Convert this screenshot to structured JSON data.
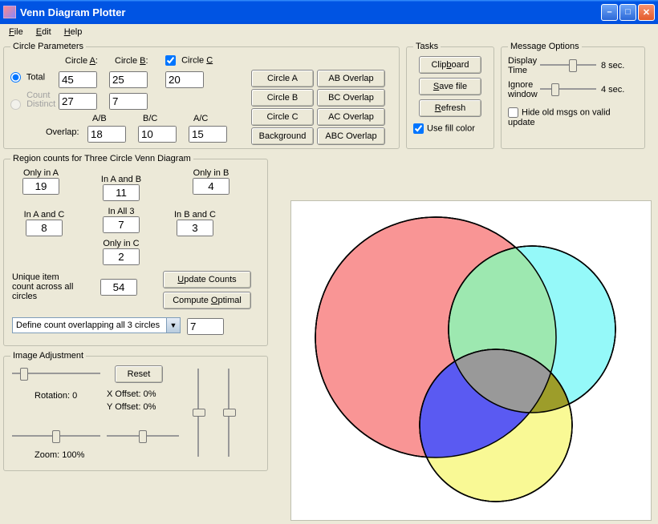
{
  "window": {
    "title": "Venn Diagram Plotter"
  },
  "menu": {
    "file": "File",
    "edit": "Edit",
    "help": "Help"
  },
  "circleParams": {
    "legend": "Circle Parameters",
    "labelA": "Circle A:",
    "labelB": "Circle B:",
    "labelC": "Circle C",
    "totalLabel": "Total",
    "countDistinctLabel": "Count Distinct",
    "totalA": "45",
    "totalB": "25",
    "totalC": "20",
    "distinctA": "27",
    "distinctB": "7",
    "overlapLabel": "Overlap:",
    "ab_hdr": "A/B",
    "bc_hdr": "B/C",
    "ac_hdr": "A/C",
    "ab": "18",
    "bc": "10",
    "ac": "15",
    "btnCircleA": "Circle A",
    "btnCircleB": "Circle B",
    "btnCircleC": "Circle C",
    "btnBackground": "Background",
    "btnAB": "AB Overlap",
    "btnBC": "BC Overlap",
    "btnAC": "AC Overlap",
    "btnABC": "ABC Overlap"
  },
  "tasks": {
    "legend": "Tasks",
    "clipboard": "Clipboard",
    "savefile": "Save file",
    "refresh": "Refresh",
    "useFillLabel": "Use fill color"
  },
  "msgopts": {
    "legend": "Message Options",
    "displayTime": "Display Time",
    "displayTimeVal": "8 sec.",
    "ignoreWindow": "Ignore window",
    "ignoreWindowVal": "4 sec.",
    "hideOld": "Hide old msgs on valid update"
  },
  "regions": {
    "legend": "Region counts for Three Circle Venn Diagram",
    "onlyA_lbl": "Only in A",
    "onlyA": "19",
    "ab_lbl": "In A and B",
    "ab": "11",
    "onlyB_lbl": "Only in B",
    "onlyB": "4",
    "ac_lbl": "In A and C",
    "ac": "8",
    "all3_lbl": "In All 3",
    "all3": "7",
    "bc_lbl": "In B and C",
    "bc": "3",
    "onlyC_lbl": "Only in C",
    "onlyC": "2",
    "unique_lbl": "Unique item count across all circles",
    "unique": "54",
    "updateCounts": "Update Counts",
    "computeOptimal": "Compute Optimal",
    "dropdown": "Define count overlapping all 3 circles",
    "dropdownVal": "7"
  },
  "imgAdj": {
    "legend": "Image Adjustment",
    "reset": "Reset",
    "rotation": "Rotation: 0",
    "xoffset": "X Offset: 0%",
    "yoffset": "Y Offset: 0%",
    "zoom": "Zoom: 100%"
  },
  "chart_data": {
    "type": "venn3",
    "sets": [
      {
        "name": "A",
        "total": 45,
        "color": "#fcc3c3"
      },
      {
        "name": "B",
        "total": 25,
        "color": "#c3fcfc"
      },
      {
        "name": "C",
        "total": 20,
        "color": "#fcfcc3"
      }
    ],
    "overlaps": {
      "AB": 18,
      "BC": 10,
      "AC": 15,
      "ABC": 7
    },
    "region_only": {
      "A": 19,
      "B": 4,
      "C": 2
    },
    "region_pair_only": {
      "AB": 11,
      "AC": 8,
      "BC": 3
    },
    "unique_total": 54
  }
}
